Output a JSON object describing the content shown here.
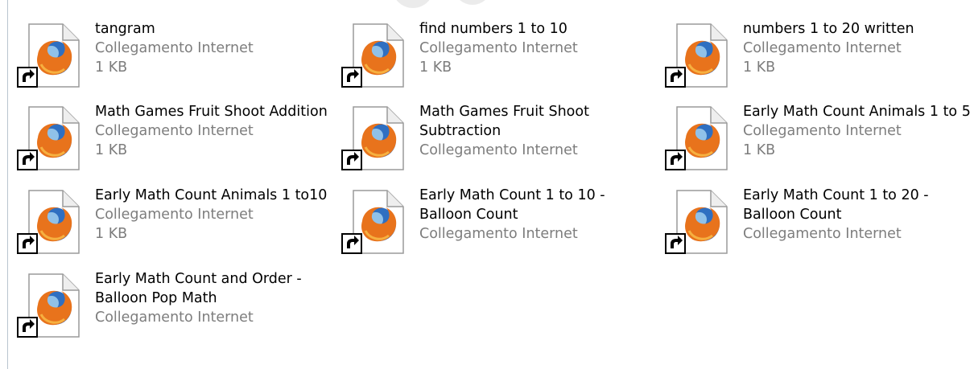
{
  "colors": {
    "name_text": "#000000",
    "detail_text": "#7d7d7d",
    "page_bg": "#ffffff"
  },
  "items": [
    {
      "name_lines": [
        "tangram"
      ],
      "type": "Collegamento Internet",
      "size": "1 KB",
      "icon": "firefox-shortcut-icon"
    },
    {
      "name_lines": [
        "find numbers 1 to 10"
      ],
      "type": "Collegamento Internet",
      "size": "1 KB",
      "icon": "firefox-shortcut-icon"
    },
    {
      "name_lines": [
        "numbers 1 to 20 written"
      ],
      "type": "Collegamento Internet",
      "size": "1 KB",
      "icon": "firefox-shortcut-icon"
    },
    {
      "name_lines": [
        "Math Games Fruit Shoot Addition"
      ],
      "type": "Collegamento Internet",
      "size": "1 KB",
      "icon": "firefox-shortcut-icon"
    },
    {
      "name_lines": [
        "Math Games Fruit Shoot",
        "Subtraction"
      ],
      "type": "Collegamento Internet",
      "size": "",
      "icon": "firefox-shortcut-icon"
    },
    {
      "name_lines": [
        "Early Math Count Animals 1 to 5"
      ],
      "type": "Collegamento Internet",
      "size": "1 KB",
      "icon": "firefox-shortcut-icon"
    },
    {
      "name_lines": [
        "Early Math Count Animals 1 to10"
      ],
      "type": "Collegamento Internet",
      "size": "1 KB",
      "icon": "firefox-shortcut-icon"
    },
    {
      "name_lines": [
        "Early Math Count 1 to 10 -",
        "Balloon Count"
      ],
      "type": "Collegamento Internet",
      "size": "",
      "icon": "firefox-shortcut-icon"
    },
    {
      "name_lines": [
        "Early Math Count 1 to 20 -",
        "Balloon Count"
      ],
      "type": "Collegamento Internet",
      "size": "",
      "icon": "firefox-shortcut-icon"
    },
    {
      "name_lines": [
        "Early Math Count and Order -",
        "Balloon Pop Math"
      ],
      "type": "Collegamento Internet",
      "size": "",
      "icon": "firefox-shortcut-icon"
    }
  ]
}
